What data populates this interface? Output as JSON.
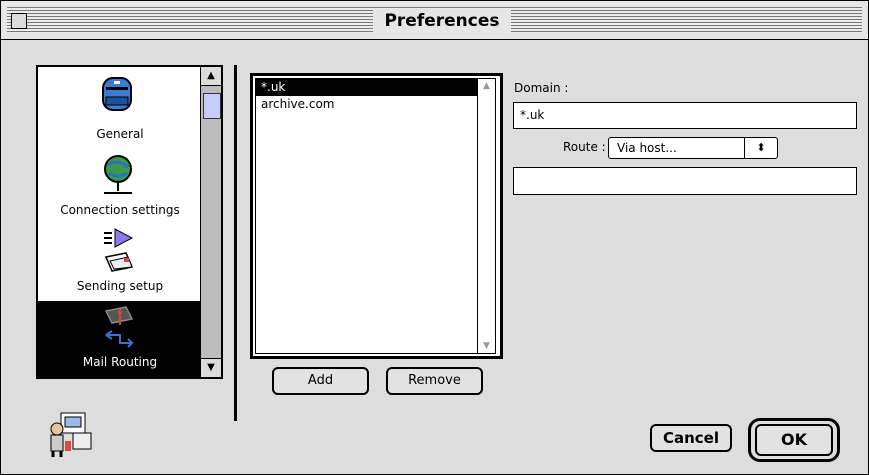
{
  "window": {
    "title": "Preferences"
  },
  "categories": [
    {
      "label": "General",
      "icon": "mailbox-icon"
    },
    {
      "label": "Connection settings",
      "icon": "globe-network-icon"
    },
    {
      "label": "Sending setup",
      "icon": "send-envelopes-icon"
    },
    {
      "label": "Mail Routing",
      "icon": "mail-routing-icon",
      "selected": true
    }
  ],
  "domains": {
    "items": [
      "*.uk",
      "archive.com"
    ],
    "selected_index": 0
  },
  "buttons": {
    "add": "Add",
    "remove": "Remove",
    "cancel": "Cancel",
    "ok": "OK"
  },
  "form": {
    "domain_label": "Domain :",
    "domain_value": "*.uk",
    "route_label": "Route :",
    "route_value": "Via host...",
    "host_value": ""
  },
  "colors": {
    "selection": "#000000",
    "background": "#dddddd",
    "scroll_thumb": "#c7cbf7"
  }
}
